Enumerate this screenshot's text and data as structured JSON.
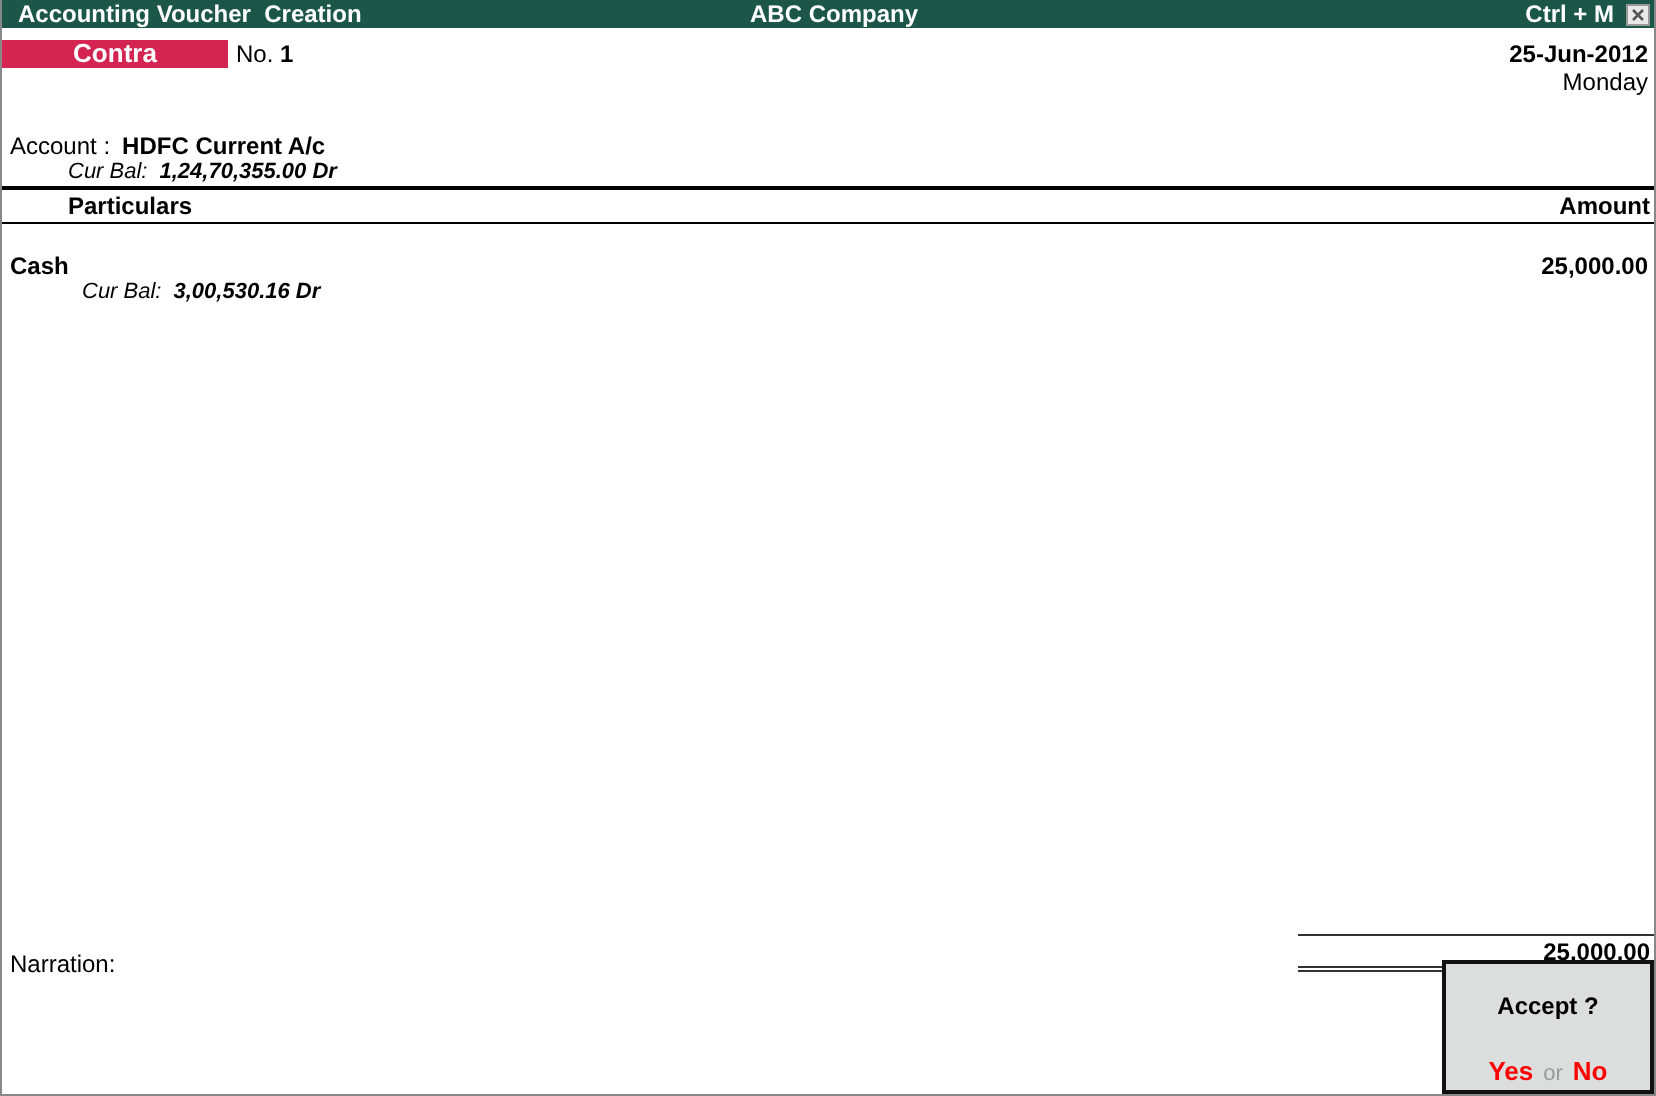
{
  "title_bar": {
    "title": "Accounting Voucher  Creation",
    "company": "ABC Company",
    "shortcut": "Ctrl + M"
  },
  "voucher": {
    "type": "Contra",
    "number_label": "No.",
    "number": "1",
    "date": "25-Jun-2012",
    "day": "Monday"
  },
  "account": {
    "label": "Account :",
    "name": "HDFC Current A/c",
    "balance_label": "Cur Bal:",
    "balance": "1,24,70,355.00 Dr"
  },
  "columns": [
    "Particulars",
    "Amount"
  ],
  "entries": [
    {
      "account": "Cash",
      "balance_label": "Cur Bal:",
      "balance": "3,00,530.16 Dr",
      "amount": "25,000.00"
    }
  ],
  "narration_label": "Narration:",
  "total": "25,000.00",
  "dialog": {
    "question": "Accept ?",
    "yes": "Yes",
    "or": "or",
    "no": "No"
  }
}
